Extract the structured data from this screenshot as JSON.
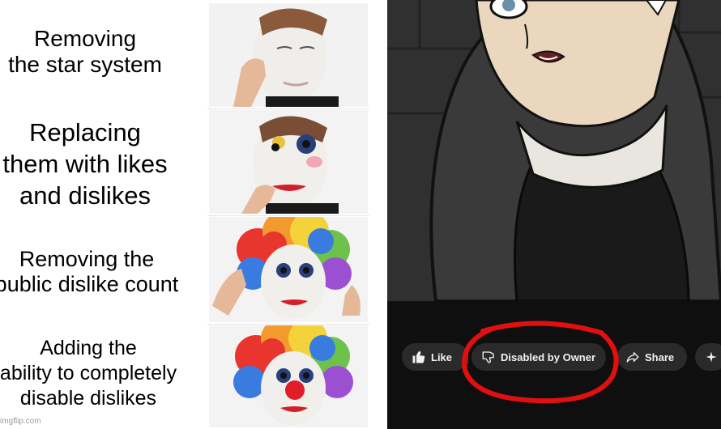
{
  "captions": [
    "Removing\nthe star system",
    "Replacing\nthem with likes\nand dislikes",
    "Removing the\npublic dislike count",
    "Adding the\nability to completely\ndisable dislikes"
  ],
  "watermark": "imgflip.com",
  "youtube_bar": {
    "like_label": "Like",
    "dislike_label": "Disabled by Owner",
    "share_label": "Share",
    "extra_icon": "sparkle-icon"
  },
  "colors": {
    "highlight_circle": "#e01010",
    "pill_bg": "#2a2a2a",
    "bar_bg": "#0f0f0f"
  }
}
